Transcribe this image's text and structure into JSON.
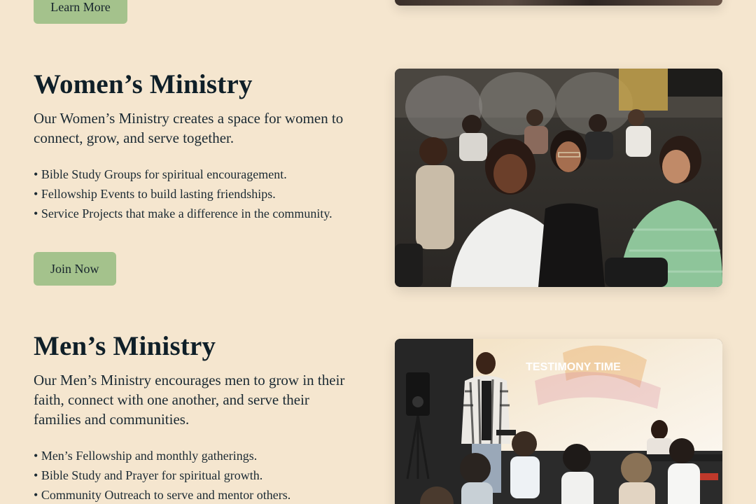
{
  "top_section": {
    "button_label": "Learn More"
  },
  "women_ministry": {
    "title": "Women’s Ministry",
    "intro": "Our Women’s Ministry creates a space for women to connect, grow, and serve together.",
    "items": [
      "Bible Study Groups for spiritual encouragement.",
      "Fellowship Events to build lasting friendships.",
      "Service Projects that make a difference in the community."
    ],
    "button_label": "Join Now"
  },
  "men_ministry": {
    "title": "Men’s Ministry",
    "intro": "Our Men’s Ministry encourages men to grow in their faith, connect with one another, and serve their families and communities.",
    "items": [
      "Men’s Fellowship and monthly gatherings.",
      "Bible Study and Prayer for spiritual growth.",
      "Community Outreach to serve and mentor others."
    ],
    "photo_screen_text": "TESTIMONY TIME"
  },
  "colors": {
    "background": "#f5e6cf",
    "button": "#a4c28c",
    "heading": "#0f1f28"
  }
}
